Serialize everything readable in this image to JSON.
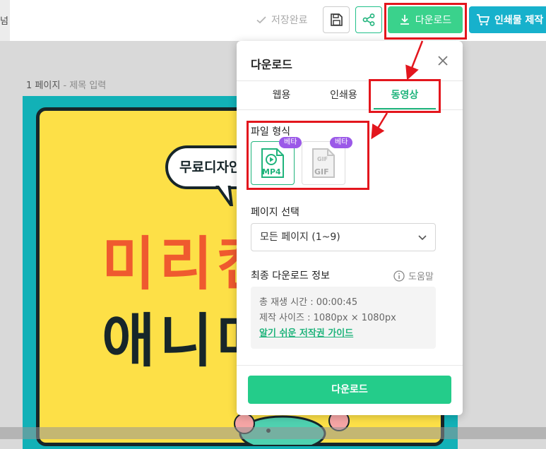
{
  "toolbar": {
    "left_text": "넘",
    "save_status": "저장완료",
    "download_label": "다운로드",
    "print_label": "인쇄물 제작"
  },
  "canvas": {
    "page_number": "1 페이지",
    "page_title_placeholder": "- 제목 입력",
    "bubble_text": "무료디자인",
    "headline_1": "미리캔",
    "headline_2": "애니메"
  },
  "panel": {
    "title": "다운로드",
    "tabs": [
      {
        "label": "웹용"
      },
      {
        "label": "인쇄용"
      },
      {
        "label": "동영상"
      }
    ],
    "active_tab": "동영상",
    "file_format_label": "파일 형식",
    "formats": [
      {
        "label": "MP4",
        "badge": "베타",
        "selected": true
      },
      {
        "label": "GIF",
        "badge": "베타",
        "selected": false
      }
    ],
    "page_select_label": "페이지 선택",
    "page_select_value": "모든 페이지 (1~9)",
    "final_info_label": "최종 다운로드 정보",
    "help_label": "도움말",
    "info_lines": [
      "총 재생 시간 : 00:00:45",
      "제작 사이즈 : 1080px × 1080px"
    ],
    "copyright_link": "알기 쉬운 저작권 가이드",
    "download_button": "다운로드"
  },
  "colors": {
    "accent_green": "#24cc8a",
    "print_blue": "#17b1cc",
    "beta_purple": "#9b59e8",
    "annotation_red": "#e3161d",
    "canvas_teal": "#12b1b7",
    "canvas_yellow": "#fde047",
    "headline_orange": "#ef5a2f"
  }
}
